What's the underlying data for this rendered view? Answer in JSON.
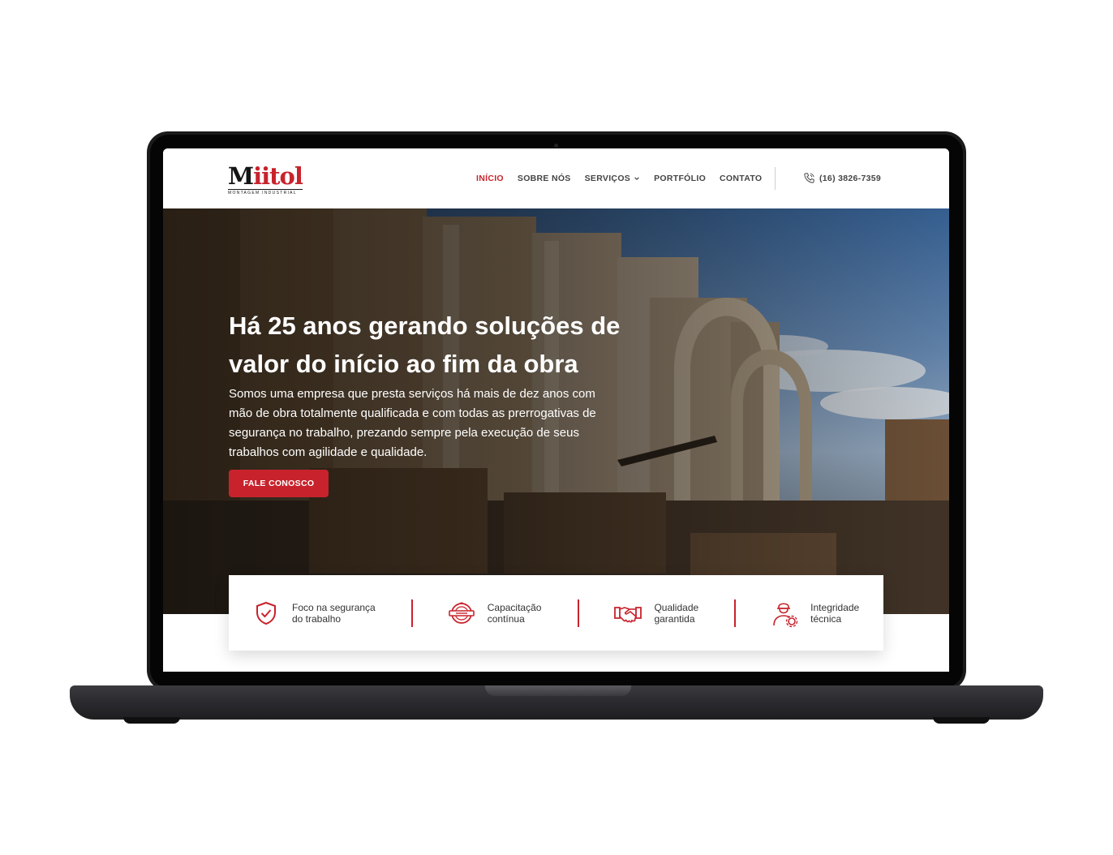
{
  "brand": {
    "name_first": "M",
    "name_rest": "iitol",
    "tagline": "MONTAGEM INDUSTRIAL",
    "accent": "#c8232c"
  },
  "nav": {
    "items": [
      {
        "label": "INÍCIO",
        "active": true
      },
      {
        "label": "SOBRE NÓS",
        "active": false
      },
      {
        "label": "SERVIÇOS",
        "active": false,
        "dropdown": true
      },
      {
        "label": "PORTFÓLIO",
        "active": false
      },
      {
        "label": "CONTATO",
        "active": false
      }
    ],
    "phone": "(16)  3826-7359",
    "phone_icon": "phone-icon"
  },
  "hero": {
    "title": "Há 25 anos gerando soluções de valor do início ao fim da obra",
    "text": "Somos uma empresa que presta serviços há mais de dez anos com mão de obra totalmente qualificada e com todas as prerrogativas de segurança no trabalho, prezando sempre pela execução de seus trabalhos com agilidade e qualidade.",
    "cta": "FALE CONOSCO"
  },
  "features": [
    {
      "line1": "Foco na segurança",
      "line2": "do trabalho",
      "icon": "shield-check-icon"
    },
    {
      "line1": "Capacitação",
      "line2": "contínua",
      "icon": "training-badge-icon"
    },
    {
      "line1": "Qualidade",
      "line2": "garantida",
      "icon": "handshake-icon"
    },
    {
      "line1": "Integridade",
      "line2": "técnica",
      "icon": "worker-gear-icon"
    }
  ]
}
